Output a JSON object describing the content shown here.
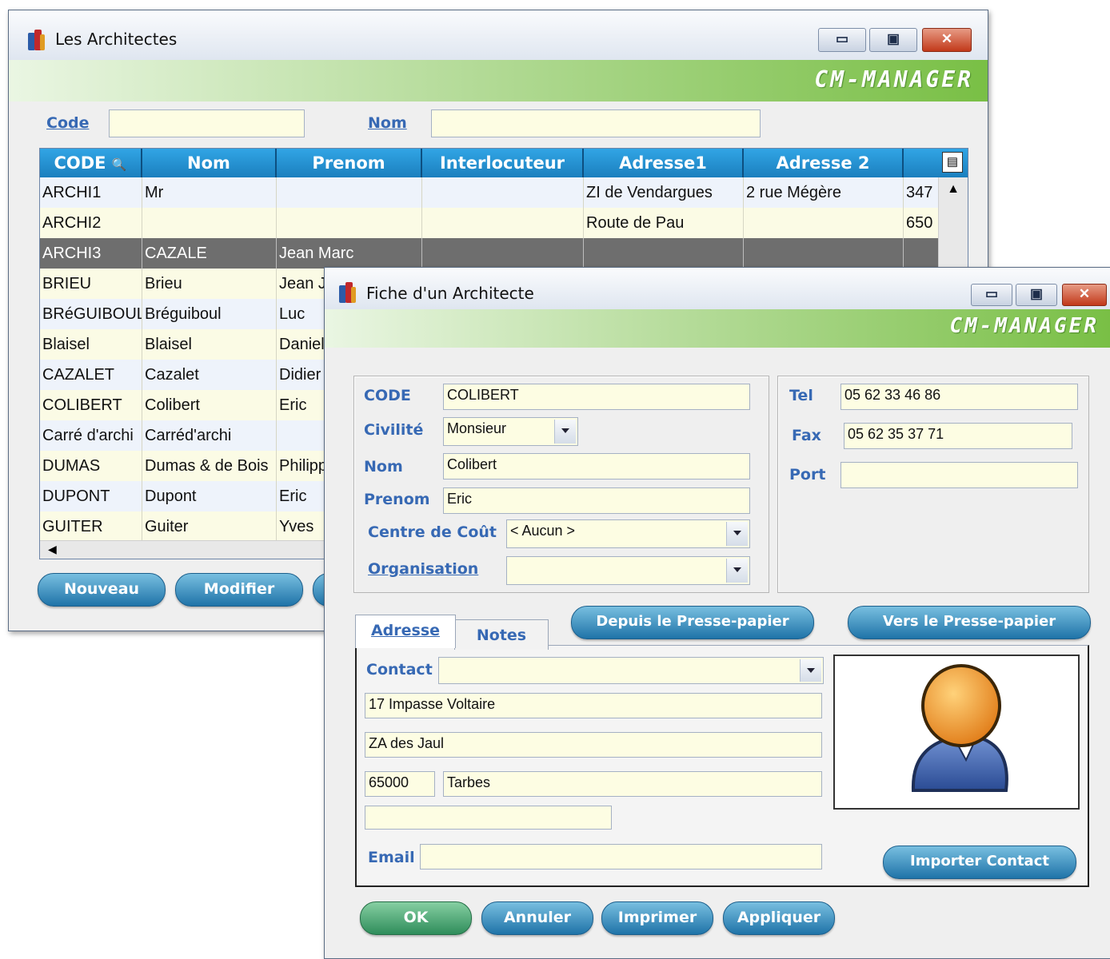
{
  "list_window": {
    "title": "Les Architectes",
    "brand": "CM-MANAGER",
    "code_label": "Code",
    "nom_label": "Nom",
    "code_value": "",
    "nom_value": "",
    "columns": [
      "CODE",
      "Nom",
      "Prenom",
      "Interlocuteur",
      "Adresse1",
      "Adresse 2",
      ""
    ],
    "rows": [
      [
        "ARCHI1",
        "Mr",
        "",
        "",
        "ZI de Vendargues",
        "2 rue Mégère",
        "347"
      ],
      [
        "ARCHI2",
        "",
        "",
        "",
        "Route de Pau",
        "",
        "650"
      ],
      [
        "ARCHI3",
        "CAZALE",
        "Jean Marc",
        "",
        "",
        "",
        ""
      ],
      [
        "BRIEU",
        "Brieu",
        "Jean J",
        "",
        "",
        "",
        ""
      ],
      [
        "BRéGUIBOUL",
        "Bréguiboul",
        "Luc",
        "",
        "",
        "",
        ""
      ],
      [
        "Blaisel",
        "Blaisel",
        "Daniel",
        "",
        "",
        "",
        ""
      ],
      [
        "CAZALET",
        "Cazalet",
        "Didier",
        "",
        "",
        "",
        ""
      ],
      [
        "COLIBERT",
        "Colibert",
        "Eric",
        "",
        "",
        "",
        ""
      ],
      [
        "Carré d'archi",
        "Carréd'archi",
        "",
        "",
        "",
        "",
        ""
      ],
      [
        "DUMAS",
        "Dumas & de Bois",
        "Philippe",
        "",
        "",
        "",
        ""
      ],
      [
        "DUPONT",
        "Dupont",
        "Eric",
        "",
        "",
        "",
        ""
      ],
      [
        "GUITER",
        "Guiter",
        "Yves",
        "",
        "",
        "",
        ""
      ]
    ],
    "selected_row": 2,
    "buttons": {
      "nouveau": "Nouveau",
      "modifier": "Modifier"
    }
  },
  "fiche_window": {
    "title": "Fiche d'un Architecte",
    "brand": "CM-MANAGER",
    "labels": {
      "code": "CODE",
      "civilite": "Civilité",
      "nom": "Nom",
      "prenom": "Prenom",
      "centre": "Centre de Coût",
      "organisation": "Organisation",
      "tel": "Tel",
      "fax": "Fax",
      "port": "Port",
      "contact": "Contact",
      "email": "Email"
    },
    "values": {
      "code": "COLIBERT",
      "civilite": "Monsieur",
      "nom": "Colibert",
      "prenom": "Eric",
      "centre": "< Aucun >",
      "organisation": "",
      "tel": "05 62 33 46 86",
      "fax": "05 62 35 37 71",
      "port": "",
      "contact": "",
      "adresse1": "17 Impasse Voltaire",
      "adresse2": "ZA des Jaul",
      "cp": "65000",
      "ville": "Tarbes",
      "pays": "",
      "email": ""
    },
    "tabs": [
      "Adresse",
      "Notes"
    ],
    "active_tab": "Adresse",
    "buttons": {
      "depuis": "Depuis le Presse-papier",
      "vers": "Vers le Presse-papier",
      "importer": "Importer Contact",
      "ok": "OK",
      "annuler": "Annuler",
      "imprimer": "Imprimer",
      "appliquer": "Appliquer"
    }
  }
}
